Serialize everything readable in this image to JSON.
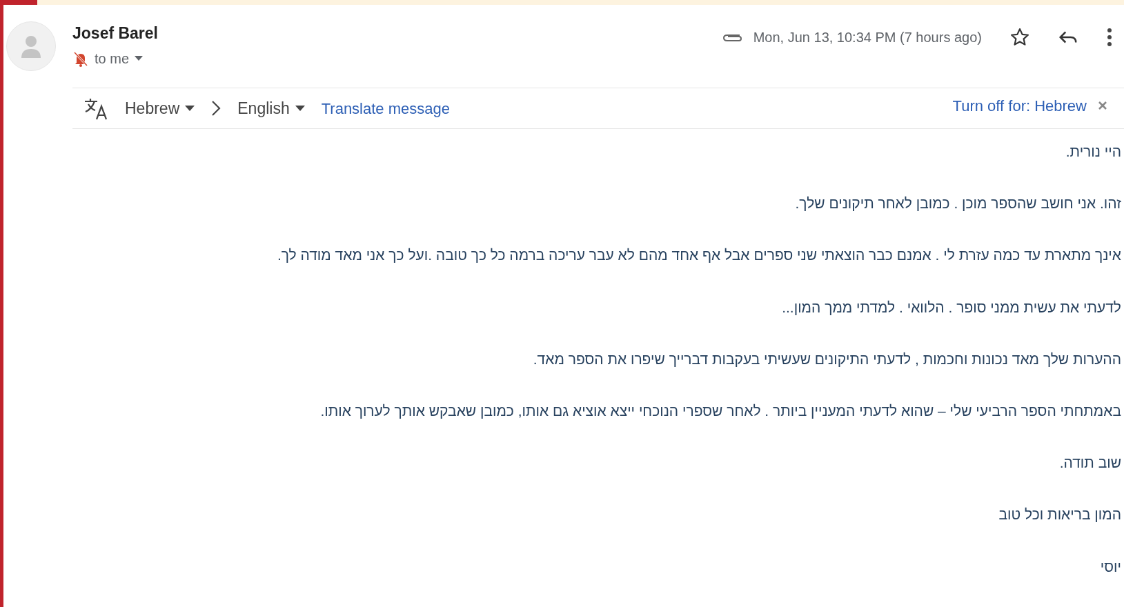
{
  "sender": {
    "name": "Josef Barel",
    "recipient": "to me",
    "date": "Mon, Jun 13, 10:34 PM (7 hours ago)"
  },
  "translate_bar": {
    "source_language": "Hebrew",
    "target_language": "English",
    "action": "Translate message",
    "turn_off": "Turn off for: Hebrew"
  },
  "body": [
    "היי נורית.",
    "זהו. אני חושב שהספר מוכן . כמובן לאחר תיקונים שלך.",
    "אינך מתארת עד כמה עזרת לי . אמנם כבר הוצאתי שני ספרים אבל אף אחד מהם לא עבר עריכה ברמה כל כך טובה .ועל כך אני מאד מודה לך.",
    "לדעתי את עשית ממני סופר . הלוואי . למדתי ממך המון...",
    "ההערות שלך מאד נכונות וחכמות , לדעתי התיקונים שעשיתי בעקבות דברייך שיפרו את הספר מאד.",
    "באמתחתי הספר הרביעי שלי – שהוא לדעתי המעניין ביותר . לאחר שספרי הנוכחי ייצא אוציא גם אותו, כמובן שאבקש אותך לערוך אותו.",
    "שוב תודה.",
    "המון בריאות וכל טוב",
    "יוסי"
  ]
}
